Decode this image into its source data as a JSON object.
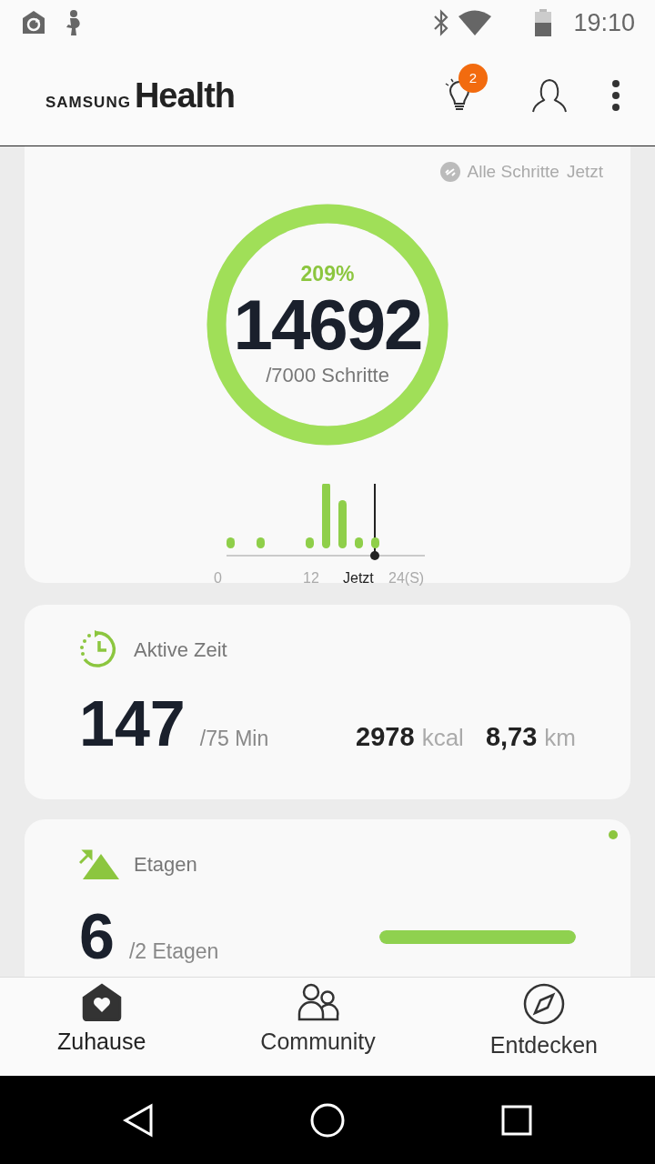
{
  "status_bar": {
    "time": "19:10"
  },
  "app_bar": {
    "logo_brand": "SAMSUNG",
    "logo_product": "Health",
    "tips_badge": "2"
  },
  "steps": {
    "source": "Alle Schritte",
    "updated": "Jetzt",
    "percent": "209%",
    "value": "14692",
    "goal": "/7000 Schritte",
    "level": 1,
    "axis_labels": [
      {
        "text": "0",
        "kind": "tick"
      },
      {
        "text": "12",
        "kind": "tick"
      },
      {
        "text": "Jetzt",
        "kind": "now"
      },
      {
        "text": "24(S)",
        "kind": "tick"
      }
    ]
  },
  "active_time": {
    "title": "Aktive Zeit",
    "value": "147",
    "goal": "/75 Min",
    "calories": "2978",
    "calories_unit": "kcal",
    "distance": "8,73",
    "distance_unit": "km"
  },
  "floors": {
    "title": "Etagen",
    "value": "6",
    "goal": "/2 Etagen",
    "level": 1,
    "new_indicator": true
  },
  "bottom_nav": [
    {
      "label": "Zuhause",
      "selected": true
    },
    {
      "label": "Community",
      "selected": false
    },
    {
      "label": "Entdecken",
      "selected": false
    }
  ]
}
